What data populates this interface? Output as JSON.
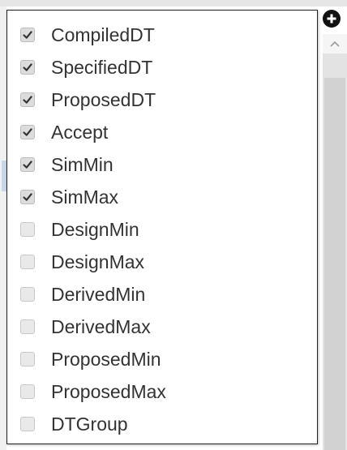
{
  "columns": {
    "items": [
      {
        "label": "CompiledDT",
        "checked": true
      },
      {
        "label": "SpecifiedDT",
        "checked": true
      },
      {
        "label": "ProposedDT",
        "checked": true
      },
      {
        "label": "Accept",
        "checked": true
      },
      {
        "label": "SimMin",
        "checked": true
      },
      {
        "label": "SimMax",
        "checked": true
      },
      {
        "label": "DesignMin",
        "checked": false
      },
      {
        "label": "DesignMax",
        "checked": false
      },
      {
        "label": "DerivedMin",
        "checked": false
      },
      {
        "label": "DerivedMax",
        "checked": false
      },
      {
        "label": "ProposedMin",
        "checked": false
      },
      {
        "label": "ProposedMax",
        "checked": false
      },
      {
        "label": "DTGroup",
        "checked": false
      }
    ]
  },
  "icons": {
    "add_button": "plus-circle-icon",
    "scroll_up": "chevron-up-icon",
    "checkbox_checked": "check-icon"
  },
  "colors": {
    "panel_border": "#222222",
    "checkbox_checked_bg": "#dcdcdc",
    "checkbox_unchecked_bg": "#e9e9e9",
    "check_mark": "#333333",
    "label_text": "#333333",
    "scrollbar_track": "#e3e3e3"
  }
}
